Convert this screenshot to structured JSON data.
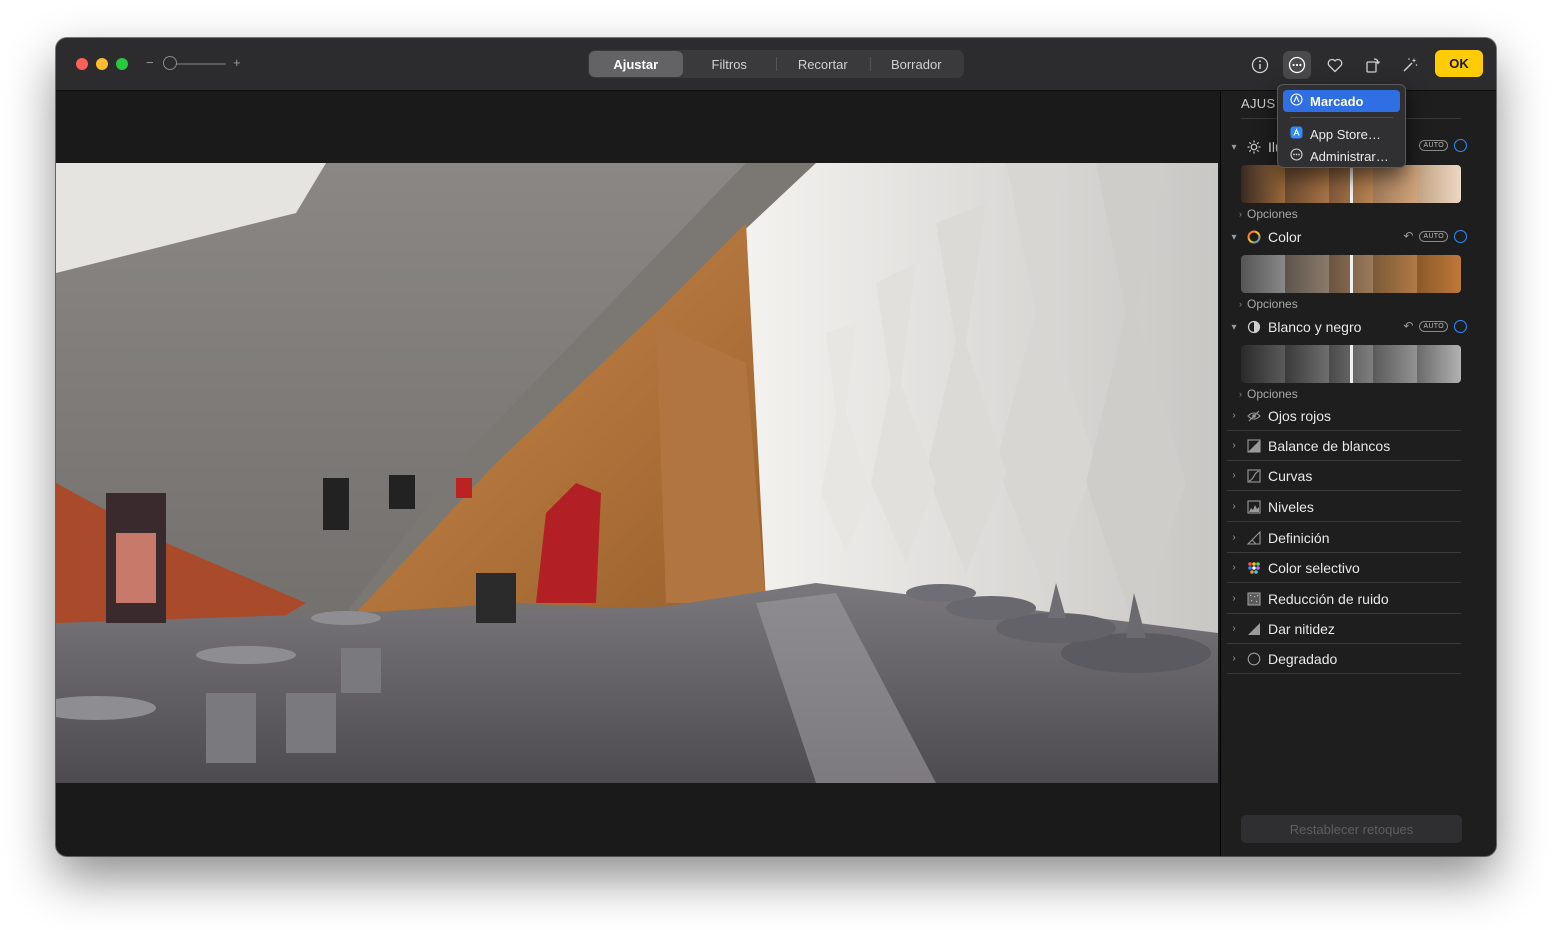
{
  "toolbar": {
    "zoom_minus": "−",
    "zoom_plus": "+",
    "tabs": [
      {
        "label": "Ajustar",
        "active": true
      },
      {
        "label": "Filtros",
        "active": false
      },
      {
        "label": "Recortar",
        "active": false
      },
      {
        "label": "Borrador",
        "active": false
      }
    ],
    "icons": [
      "info-icon",
      "extensions-icon",
      "heart-icon",
      "rotate-icon",
      "magic-wand-icon"
    ],
    "ok_label": "OK",
    "ok_color": "#ffcc00"
  },
  "extensions_menu": {
    "items": [
      {
        "label": "Marcado",
        "icon": "markup-icon",
        "highlighted": true
      },
      {
        "label": "App Store…",
        "icon": "app-store-icon",
        "highlighted": false
      },
      {
        "label": "Administrar…",
        "icon": "more-icon",
        "highlighted": false
      }
    ]
  },
  "sidebar": {
    "title": "AJUS",
    "sections": [
      {
        "label": "Ilu",
        "icon": "sun-icon",
        "auto_label": "AUTO",
        "options_label": "Opciones"
      },
      {
        "label": "Color",
        "icon": "color-wheel-icon",
        "auto_label": "AUTO",
        "options_label": "Opciones"
      },
      {
        "label": "Blanco y negro",
        "icon": "half-circle-icon",
        "auto_label": "AUTO",
        "options_label": "Opciones"
      }
    ],
    "tools": [
      {
        "label": "Ojos rojos",
        "icon": "eye-icon"
      },
      {
        "label": "Balance de blancos",
        "icon": "white-balance-icon"
      },
      {
        "label": "Curvas",
        "icon": "curves-icon"
      },
      {
        "label": "Niveles",
        "icon": "levels-icon"
      },
      {
        "label": "Definición",
        "icon": "definition-icon"
      },
      {
        "label": "Color selectivo",
        "icon": "selective-color-icon"
      },
      {
        "label": "Reducción de ruido",
        "icon": "noise-reduction-icon"
      },
      {
        "label": "Dar nitidez",
        "icon": "sharpen-icon"
      },
      {
        "label": "Degradado",
        "icon": "vignette-icon"
      }
    ],
    "reset_label": "Restablecer retoques"
  },
  "colors": {
    "accent": "#2f8cff",
    "menu_highlight": "#2f6fe3"
  }
}
